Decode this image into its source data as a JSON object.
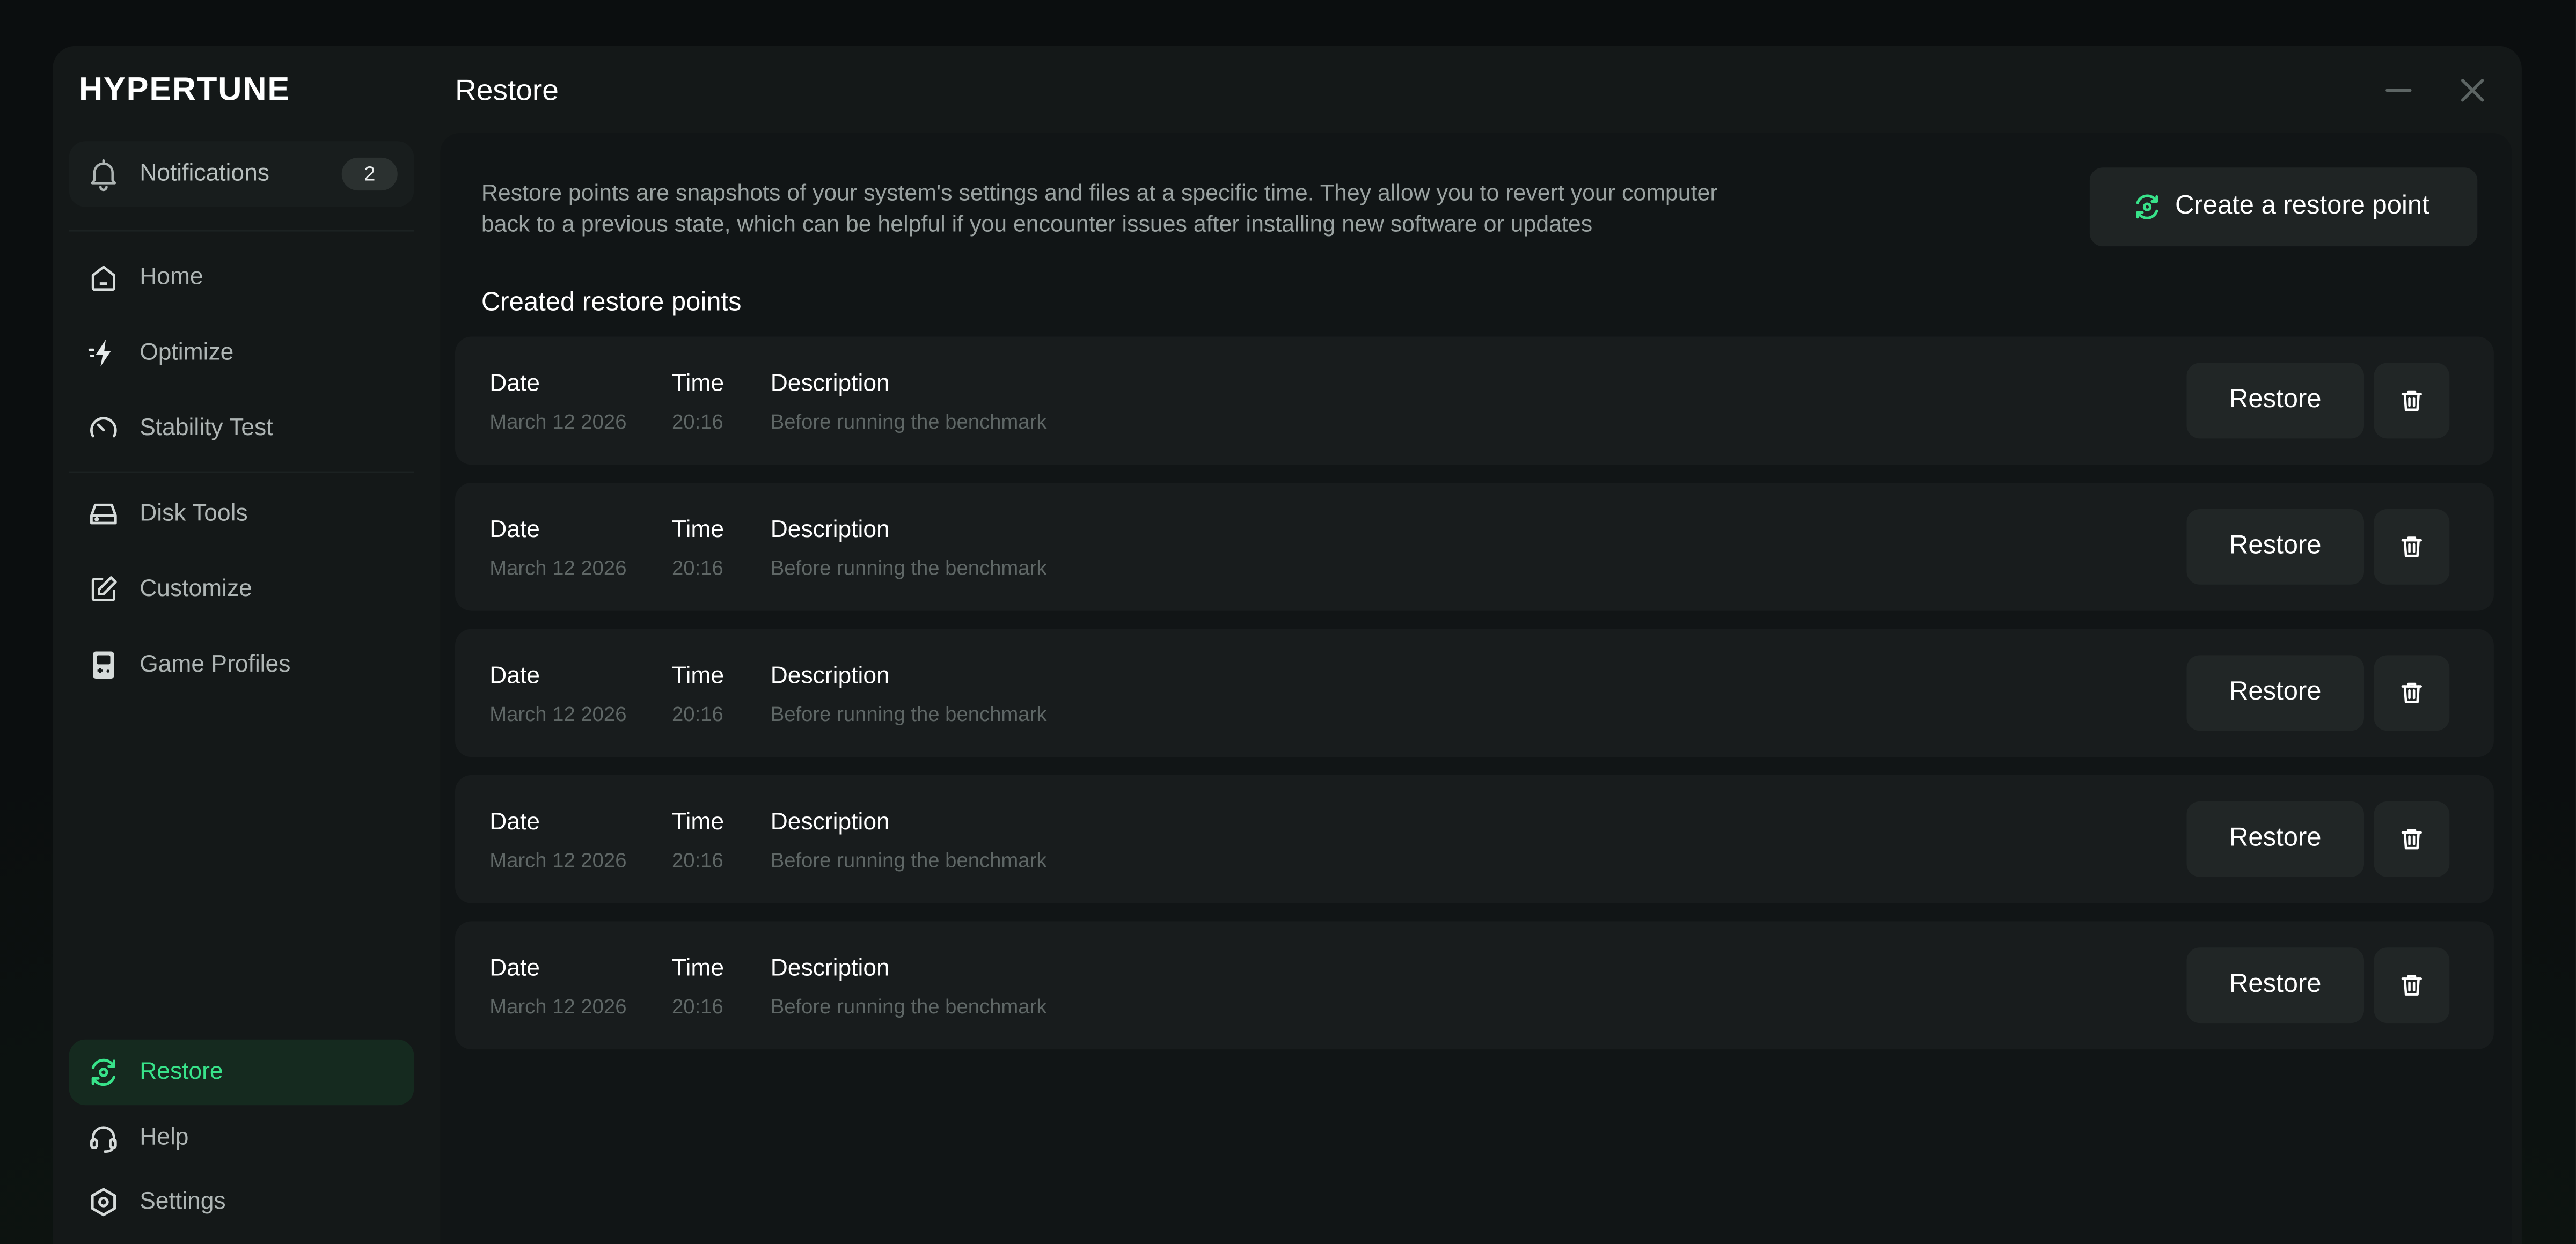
{
  "app": {
    "brand": "HYPERTUNE",
    "page_title": "Restore"
  },
  "sidebar": {
    "notifications": {
      "label": "Notifications",
      "count": "2",
      "icon": "bell-icon"
    },
    "items": [
      {
        "label": "Home",
        "icon": "home-icon"
      },
      {
        "label": "Optimize",
        "icon": "bolt-icon"
      },
      {
        "label": "Stability Test",
        "icon": "gauge-icon"
      },
      {
        "label": "Disk Tools",
        "icon": "disk-icon"
      },
      {
        "label": "Customize",
        "icon": "edit-icon"
      },
      {
        "label": "Game Profiles",
        "icon": "gamepad-icon"
      },
      {
        "label": "Restore",
        "icon": "restore-icon",
        "active": true
      },
      {
        "label": "Help",
        "icon": "headset-icon"
      },
      {
        "label": "Settings",
        "icon": "settings-icon"
      }
    ]
  },
  "main": {
    "intro": "Restore points are snapshots of your system's settings and files at a specific time. They allow you to revert your computer back to a previous state, which can be helpful if you encounter issues after installing new software or updates",
    "create_button": "Create a restore point",
    "section_title": "Created restore points",
    "columns": {
      "date": "Date",
      "time": "Time",
      "description": "Description"
    },
    "restore_label": "Restore",
    "rows": [
      {
        "date": "March 12 2026",
        "time": "20:16",
        "description": "Before running the benchmark"
      },
      {
        "date": "March 12 2026",
        "time": "20:16",
        "description": "Before running the benchmark"
      },
      {
        "date": "March 12 2026",
        "time": "20:16",
        "description": "Before running the benchmark"
      },
      {
        "date": "March 12 2026",
        "time": "20:16",
        "description": "Before running the benchmark"
      },
      {
        "date": "March 12 2026",
        "time": "20:16",
        "description": "Before running the benchmark"
      }
    ]
  },
  "colors": {
    "accent": "#38e38a",
    "panel": "#111516",
    "window": "#141818"
  }
}
